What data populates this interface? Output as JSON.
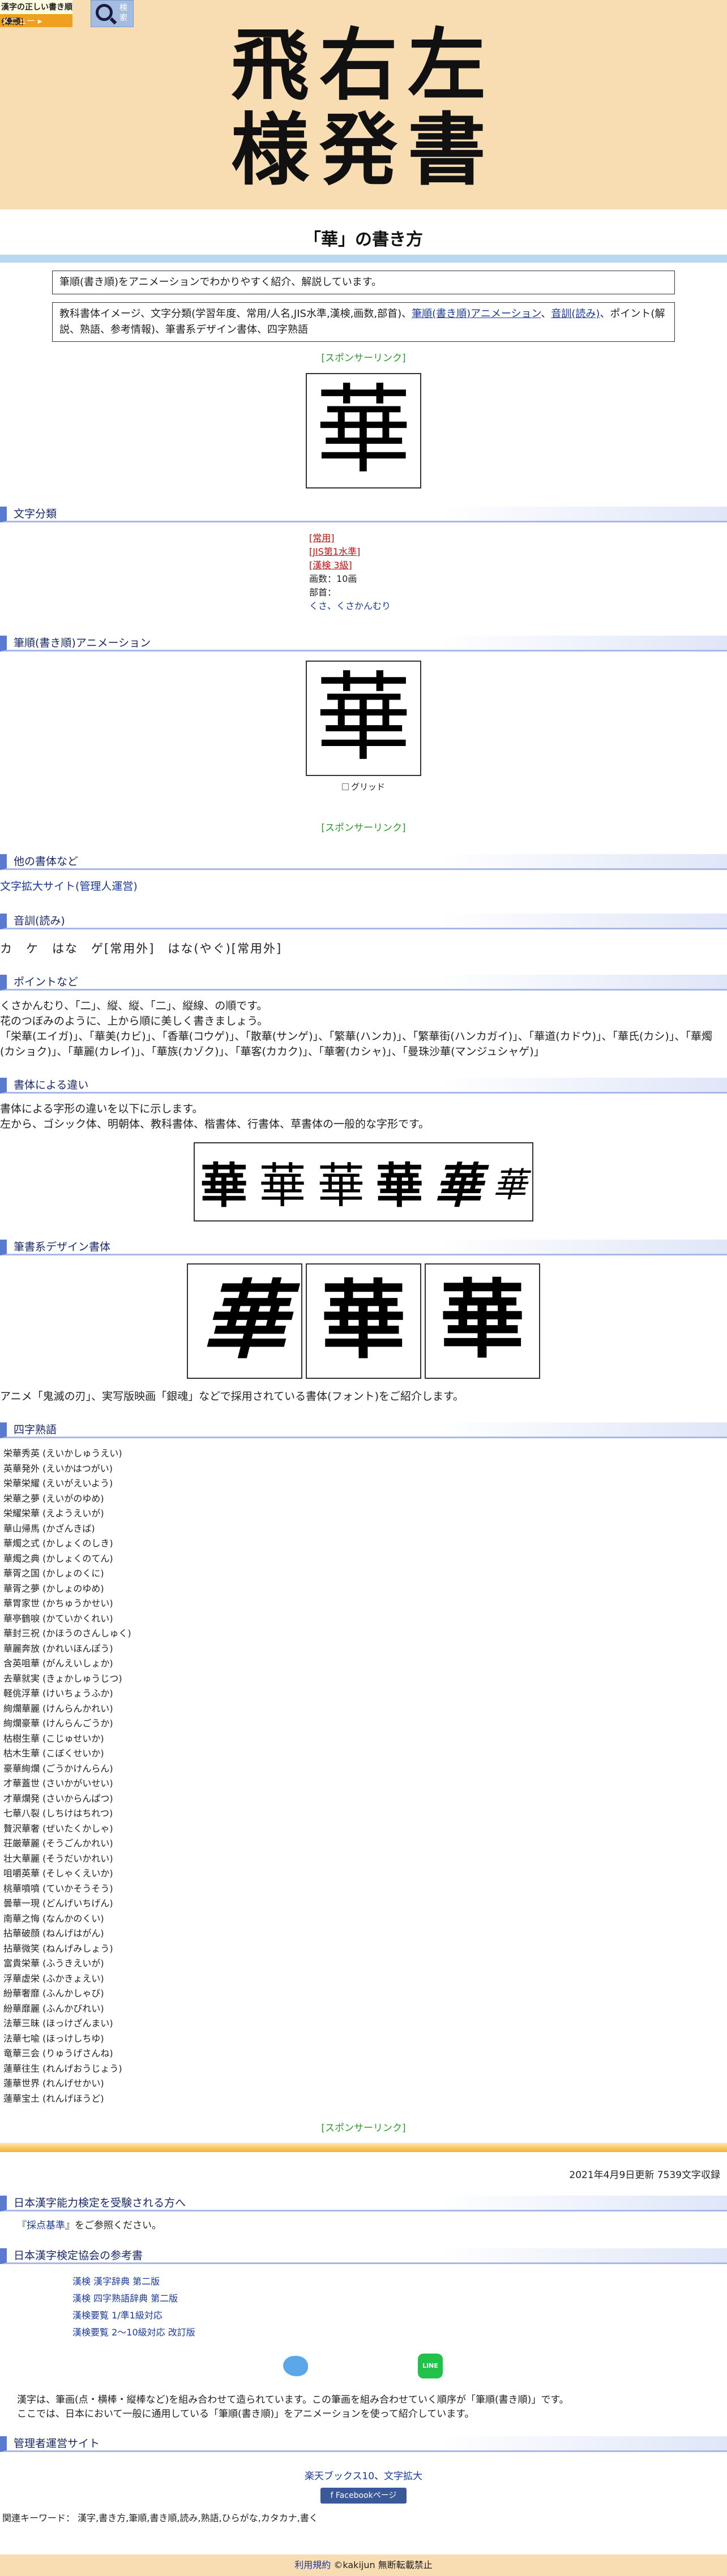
{
  "header": {
    "logo_line": "漢字の正しい書き順(筆順)",
    "menu_label": "メニュー ▸",
    "search_label": "検索",
    "hero_line1": "飛右左",
    "hero_line2": "様発書"
  },
  "page_title": "「華」の書き方",
  "intro_box": "筆順(書き順)をアニメーションでわかりやすく紹介、解説しています。",
  "toc_box": {
    "prefix": "教科書体イメージ、文字分類(学習年度、常用/人名,JIS水準,漢検,画数,部首)、",
    "link1": "筆順(書き順)アニメーション",
    "sep1": "、",
    "link2": "音訓(読み)",
    "suffix": "、ポイント(解説、熟語、参考情報)、筆書系デザイン書体、四字熟語"
  },
  "sponsor": "[スポンサーリンク]",
  "kanji": "華",
  "sections": {
    "classification": "文字分類",
    "animation": "筆順(書き順)アニメーション",
    "other_fonts": "他の書体など",
    "readings": "音訓(読み)",
    "points": "ポイントなど",
    "typeface_diff": "書体による違い",
    "brush_design": "筆書系デザイン書体",
    "yoji": "四字熟語",
    "kentei": "日本漢字能力検定を受験される方へ",
    "references": "日本漢字検定協会の参考書",
    "admin": "管理者運営サイト"
  },
  "classification": {
    "joyo": "[常用]",
    "jis": "[JIS第1水準]",
    "kanken": "[漢検 3級]",
    "strokes": "画数：10画",
    "radical_label": "部首：",
    "radical": "くさ、くさかんむり"
  },
  "grid_label": "グリッド",
  "other_fonts_link": "文字拡大サイト(管理人運営)",
  "readings_text": "カ　ケ　はな　ゲ[常用外]　はな(やぐ)[常用外]",
  "points": {
    "line1": "くさかんむり、「二」、縦、縦、「二」、縦線、の順です。",
    "line2": "花のつぼみのように、上から順に美しく書きましょう。",
    "line3": "「栄華(エイガ)」、「華美(カビ)」、「香華(コウゲ)」、「散華(サンゲ)」、「繁華(ハンカ)」、「繁華街(ハンカガイ)」、「華道(カドウ)」、「華氏(カシ)」、「華燭(カショク)」、「華麗(カレイ)」、「華族(カゾク)」、「華客(カカク)」、「華奢(カシャ)」、「曼珠沙華(マンジュシャゲ)」"
  },
  "typeface": {
    "line1": "書体による字形の違いを以下に示します。",
    "line2": "左から、ゴシック体、明朝体、教科書体、楷書体、行書体、草書体の一般的な字形です。",
    "glyphs": [
      "華",
      "華",
      "華",
      "華",
      "華",
      "華"
    ]
  },
  "brush_caption": "アニメ「鬼滅の刃」、実写版映画「銀魂」などで採用されている書体(フォント)をご紹介します。",
  "yoji": [
    "栄華秀英 (えいかしゅうえい)",
    "英華発外 (えいかはつがい)",
    "栄華栄耀 (えいがえいよう)",
    "栄華之夢 (えいがのゆめ)",
    "栄耀栄華 (えようえいが)",
    "華山帰馬 (かざんきば)",
    "華燭之式 (かしょくのしき)",
    "華燭之典 (かしょくのてん)",
    "華胥之国 (かしょのくに)",
    "華胥之夢 (かしょのゆめ)",
    "華胃家世 (かちゅうかせい)",
    "華亭鶴唳 (かていかくれい)",
    "華封三祝 (かほうのさんしゅく)",
    "華麗奔放 (かれいほんぽう)",
    "含英咀華 (がんえいしょか)",
    "去華就実 (きょかしゅうじつ)",
    "軽佻浮華 (けいちょうふか)",
    "絢爛華麗 (けんらんかれい)",
    "絢爛豪華 (けんらんごうか)",
    "枯樹生華 (こじゅせいか)",
    "枯木生華 (こぼくせいか)",
    "豪華絢爛 (ごうかけんらん)",
    "才華蓋世 (さいかがいせい)",
    "才華爛発 (さいからんぱつ)",
    "七華八裂 (しちけはちれつ)",
    "贅沢華奢 (ぜいたくかしゃ)",
    "荘厳華麗 (そうごんかれい)",
    "壮大華麗 (そうだいかれい)",
    "咀嚼英華 (そしゃくえいか)",
    "桃華噴噴 (ていかそうそう)",
    "曇華一現 (どんげいちげん)",
    "南華之悔 (なんかのくい)",
    "拈華破顔 (ねんげはがん)",
    "拈華微笑 (ねんげみしょう)",
    "富貴栄華 (ふうきえいが)",
    "浮華虚栄 (ふかきょえい)",
    "紛華奢靡 (ふんかしゃび)",
    "紛華靡麗 (ふんかびれい)",
    "法華三昧 (ほっけざんまい)",
    "法華七喩 (ほっけしちゆ)",
    "竜華三会 (りゅうげさんね)",
    "蓮華往生 (れんげおうじょう)",
    "蓮華世界 (れんげせかい)",
    "蓮華宝土 (れんげほうど)"
  ],
  "updated": "2021年4月9日更新 7539文字収録",
  "kentei_text_pre": "『",
  "kentei_link": "採点基準",
  "kentei_text_post": "』をご参照ください。",
  "references": [
    "漢検 漢字辞典 第二版",
    "漢検 四字熟語辞典 第二版",
    "漢検要覧 1/準1級対応",
    "漢検要覧 2〜10級対応 改訂版"
  ],
  "line_icon_label": "LINE",
  "site_intro": {
    "line1": "漢字は、筆画(点・横棒・縦棒など)を組み合わせて造られています。この筆画を組み合わせていく順序が「筆順(書き順)」です。",
    "line2": "ここでは、日本において一般に通用している「筆順(書き順)」をアニメーションを使って紹介しています。"
  },
  "admin_links": {
    "link1": "楽天ブックス10",
    "sep": "、",
    "link2": "文字拡大"
  },
  "facebook_label": "f  Facebookページ",
  "keywords": "関連キーワード： 漢字,書き方,筆順,書き順,読み,熟語,ひらがな,カタカナ,書く",
  "footer": {
    "link": "利用規約",
    "copyright": "©kakijun 無断転載禁止"
  }
}
